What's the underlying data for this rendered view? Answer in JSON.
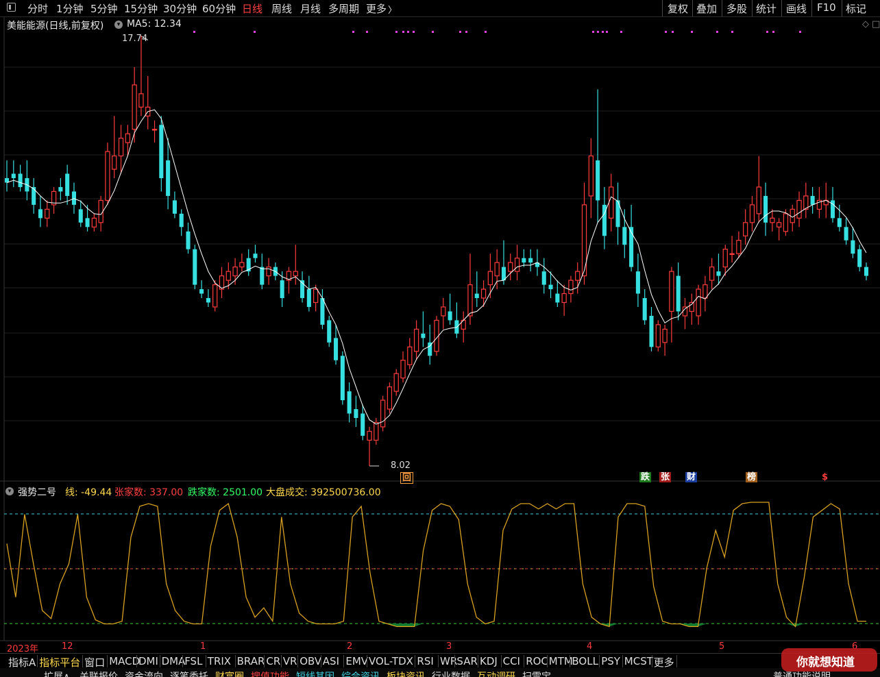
{
  "toolbar": {
    "periods": [
      "分时",
      "1分钟",
      "5分钟",
      "15分钟",
      "30分钟",
      "60分钟",
      "日线",
      "周线",
      "月线",
      "多周期",
      "更多"
    ],
    "active_period": "日线",
    "more_arrow": "〉",
    "tools": [
      "复权",
      "叠加",
      "多股",
      "统计",
      "画线",
      "F10",
      "标记"
    ]
  },
  "header": {
    "stock_title": "美能能源(日线,前复权)",
    "ma_label": "MA5: 12.34",
    "high_label": "17.74",
    "low_label": "8.02"
  },
  "indicator": {
    "name": "强势二号",
    "line_label": "线: -49.44",
    "up_label": "张家数: 337.00",
    "down_label": "跌家数: 2501.00",
    "volume_label": "大盘成交: 392500736.00"
  },
  "markers": {
    "hui": "回",
    "die": "跌",
    "zhang": "张",
    "cai": "财",
    "bang": "榜",
    "dollar": "$"
  },
  "date_axis": [
    "2023年",
    "12",
    "1",
    "2",
    "3",
    "4",
    "5",
    "6"
  ],
  "indicator_tabs": [
    "指标A",
    "指标平台",
    "窗口",
    "MACD",
    "DMI",
    "DMA",
    "FSL",
    "TRIX",
    "BRAR",
    "CR",
    "VR",
    "OBV",
    "ASI",
    "EMV",
    "VOL-TDX",
    "RSI",
    "WR",
    "SAR",
    "KDJ",
    "CCI",
    "ROC",
    "MTM",
    "BOLL",
    "PSY",
    "MCST",
    "更多"
  ],
  "bottom_items": [
    "扩展∧",
    "关联报价",
    "资金流向",
    "逐笔委托",
    "财富圈",
    "搜值功能",
    "短线其因",
    "综合资讯",
    "板块资讯",
    "行业数据",
    "互动调研",
    "扫雷宝"
  ],
  "bottom_right": "普通功能说明",
  "watermark": "你就想知道",
  "chart_data": {
    "type": "candlestick",
    "series_name": "美能能源",
    "ma_period": 5,
    "price_range": [
      8.02,
      17.74
    ],
    "candles": [
      {
        "o": 14.5,
        "h": 14.9,
        "l": 14.2,
        "c": 14.4
      },
      {
        "o": 14.6,
        "h": 14.9,
        "l": 14.3,
        "c": 14.5
      },
      {
        "o": 14.6,
        "h": 14.8,
        "l": 14.2,
        "c": 14.3
      },
      {
        "o": 14.5,
        "h": 14.9,
        "l": 14.0,
        "c": 14.2
      },
      {
        "o": 14.3,
        "h": 14.5,
        "l": 13.7,
        "c": 13.9
      },
      {
        "o": 13.8,
        "h": 14.1,
        "l": 13.4,
        "c": 13.6
      },
      {
        "o": 13.6,
        "h": 14.0,
        "l": 13.4,
        "c": 13.8
      },
      {
        "o": 13.9,
        "h": 14.3,
        "l": 13.7,
        "c": 14.2
      },
      {
        "o": 14.3,
        "h": 14.5,
        "l": 14.0,
        "c": 14.2
      },
      {
        "o": 14.6,
        "h": 14.8,
        "l": 13.9,
        "c": 14.1
      },
      {
        "o": 14.2,
        "h": 14.4,
        "l": 13.7,
        "c": 13.9
      },
      {
        "o": 13.8,
        "h": 14.0,
        "l": 13.4,
        "c": 13.5
      },
      {
        "o": 13.6,
        "h": 13.9,
        "l": 13.3,
        "c": 13.4
      },
      {
        "o": 13.4,
        "h": 13.7,
        "l": 13.3,
        "c": 13.6
      },
      {
        "o": 13.5,
        "h": 14.1,
        "l": 13.3,
        "c": 14.0
      },
      {
        "o": 14.0,
        "h": 15.3,
        "l": 13.9,
        "c": 15.1
      },
      {
        "o": 14.7,
        "h": 15.9,
        "l": 14.5,
        "c": 15.0
      },
      {
        "o": 15.0,
        "h": 15.7,
        "l": 14.6,
        "c": 15.4
      },
      {
        "o": 15.3,
        "h": 15.7,
        "l": 15.0,
        "c": 15.5
      },
      {
        "o": 15.6,
        "h": 17.0,
        "l": 15.3,
        "c": 16.6
      },
      {
        "o": 16.1,
        "h": 17.7,
        "l": 15.9,
        "c": 16.4
      },
      {
        "o": 15.9,
        "h": 16.8,
        "l": 15.6,
        "c": 16.1
      },
      {
        "o": 15.6,
        "h": 15.8,
        "l": 15.3,
        "c": 15.6
      },
      {
        "o": 15.7,
        "h": 15.9,
        "l": 14.2,
        "c": 14.5
      },
      {
        "o": 14.9,
        "h": 15.4,
        "l": 13.8,
        "c": 14.1
      },
      {
        "o": 14.0,
        "h": 14.2,
        "l": 13.6,
        "c": 13.7
      },
      {
        "o": 13.7,
        "h": 13.8,
        "l": 13.2,
        "c": 13.4
      },
      {
        "o": 13.3,
        "h": 13.5,
        "l": 12.8,
        "c": 12.9
      },
      {
        "o": 12.9,
        "h": 13.0,
        "l": 12.0,
        "c": 12.1
      },
      {
        "o": 12.0,
        "h": 12.2,
        "l": 11.8,
        "c": 11.9
      },
      {
        "o": 11.8,
        "h": 12.0,
        "l": 11.6,
        "c": 11.7
      },
      {
        "o": 11.6,
        "h": 12.2,
        "l": 11.5,
        "c": 12.1
      },
      {
        "o": 12.0,
        "h": 12.5,
        "l": 11.8,
        "c": 12.3
      },
      {
        "o": 12.2,
        "h": 12.6,
        "l": 12.0,
        "c": 12.4
      },
      {
        "o": 12.3,
        "h": 12.7,
        "l": 12.1,
        "c": 12.5
      },
      {
        "o": 12.5,
        "h": 12.8,
        "l": 12.4,
        "c": 12.6
      },
      {
        "o": 12.7,
        "h": 12.9,
        "l": 12.3,
        "c": 12.4
      },
      {
        "o": 12.8,
        "h": 13.0,
        "l": 12.6,
        "c": 12.7
      },
      {
        "o": 12.5,
        "h": 12.8,
        "l": 12.0,
        "c": 12.1
      },
      {
        "o": 12.3,
        "h": 12.7,
        "l": 12.1,
        "c": 12.5
      },
      {
        "o": 12.5,
        "h": 12.6,
        "l": 12.2,
        "c": 12.3
      },
      {
        "o": 12.2,
        "h": 12.4,
        "l": 11.6,
        "c": 11.8
      },
      {
        "o": 12.2,
        "h": 12.5,
        "l": 11.9,
        "c": 12.4
      },
      {
        "o": 12.3,
        "h": 13.0,
        "l": 12.1,
        "c": 12.4
      },
      {
        "o": 12.2,
        "h": 12.4,
        "l": 11.7,
        "c": 11.8
      },
      {
        "o": 12.0,
        "h": 12.3,
        "l": 11.5,
        "c": 11.6
      },
      {
        "o": 11.7,
        "h": 12.1,
        "l": 11.5,
        "c": 12.0
      },
      {
        "o": 11.8,
        "h": 12.0,
        "l": 11.1,
        "c": 11.2
      },
      {
        "o": 11.3,
        "h": 11.4,
        "l": 10.7,
        "c": 10.8
      },
      {
        "o": 10.9,
        "h": 11.2,
        "l": 10.3,
        "c": 10.4
      },
      {
        "o": 10.5,
        "h": 10.6,
        "l": 9.4,
        "c": 9.5
      },
      {
        "o": 9.7,
        "h": 9.9,
        "l": 9.0,
        "c": 9.2
      },
      {
        "o": 9.3,
        "h": 9.6,
        "l": 8.9,
        "c": 9.1
      },
      {
        "o": 9.2,
        "h": 9.4,
        "l": 8.6,
        "c": 8.7
      },
      {
        "o": 8.6,
        "h": 8.9,
        "l": 8.02,
        "c": 8.8
      },
      {
        "o": 8.6,
        "h": 9.1,
        "l": 8.5,
        "c": 9.0
      },
      {
        "o": 8.9,
        "h": 9.6,
        "l": 8.8,
        "c": 9.5
      },
      {
        "o": 9.3,
        "h": 9.9,
        "l": 9.2,
        "c": 9.8
      },
      {
        "o": 9.7,
        "h": 10.2,
        "l": 9.6,
        "c": 10.1
      },
      {
        "o": 10.0,
        "h": 10.6,
        "l": 9.9,
        "c": 10.4
      },
      {
        "o": 10.3,
        "h": 10.9,
        "l": 10.2,
        "c": 10.7
      },
      {
        "o": 10.6,
        "h": 11.3,
        "l": 10.4,
        "c": 11.1
      },
      {
        "o": 11.0,
        "h": 11.5,
        "l": 10.7,
        "c": 10.9
      },
      {
        "o": 10.8,
        "h": 11.2,
        "l": 10.3,
        "c": 10.5
      },
      {
        "o": 10.6,
        "h": 11.4,
        "l": 10.5,
        "c": 11.3
      },
      {
        "o": 11.4,
        "h": 11.8,
        "l": 11.1,
        "c": 11.6
      },
      {
        "o": 11.5,
        "h": 11.9,
        "l": 11.2,
        "c": 11.3
      },
      {
        "o": 11.3,
        "h": 11.7,
        "l": 10.9,
        "c": 11.0
      },
      {
        "o": 11.1,
        "h": 11.5,
        "l": 10.8,
        "c": 11.3
      },
      {
        "o": 11.4,
        "h": 12.8,
        "l": 11.2,
        "c": 12.1
      },
      {
        "o": 11.9,
        "h": 12.4,
        "l": 11.6,
        "c": 11.8
      },
      {
        "o": 11.8,
        "h": 12.2,
        "l": 11.6,
        "c": 12.0
      },
      {
        "o": 12.1,
        "h": 12.8,
        "l": 11.8,
        "c": 12.4
      },
      {
        "o": 12.3,
        "h": 12.9,
        "l": 12.0,
        "c": 12.6
      },
      {
        "o": 12.5,
        "h": 13.1,
        "l": 12.1,
        "c": 12.2
      },
      {
        "o": 12.4,
        "h": 12.8,
        "l": 12.2,
        "c": 12.6
      },
      {
        "o": 12.4,
        "h": 13.0,
        "l": 12.2,
        "c": 12.7
      },
      {
        "o": 12.7,
        "h": 12.9,
        "l": 12.5,
        "c": 12.6
      },
      {
        "o": 12.7,
        "h": 12.9,
        "l": 12.4,
        "c": 12.6
      },
      {
        "o": 12.6,
        "h": 12.9,
        "l": 12.3,
        "c": 12.5
      },
      {
        "o": 12.4,
        "h": 12.7,
        "l": 11.9,
        "c": 12.1
      },
      {
        "o": 12.1,
        "h": 12.4,
        "l": 11.8,
        "c": 12.0
      },
      {
        "o": 11.9,
        "h": 12.2,
        "l": 11.6,
        "c": 11.7
      },
      {
        "o": 11.7,
        "h": 12.1,
        "l": 11.4,
        "c": 11.9
      },
      {
        "o": 11.9,
        "h": 12.3,
        "l": 11.7,
        "c": 12.2
      },
      {
        "o": 12.2,
        "h": 12.6,
        "l": 11.9,
        "c": 12.4
      },
      {
        "o": 12.3,
        "h": 14.4,
        "l": 12.1,
        "c": 13.9
      },
      {
        "o": 14.1,
        "h": 15.4,
        "l": 13.6,
        "c": 15.0
      },
      {
        "o": 14.9,
        "h": 16.5,
        "l": 13.5,
        "c": 14.0
      },
      {
        "o": 13.9,
        "h": 14.3,
        "l": 12.9,
        "c": 13.2
      },
      {
        "o": 13.6,
        "h": 14.6,
        "l": 13.3,
        "c": 14.3
      },
      {
        "o": 14.0,
        "h": 14.4,
        "l": 13.0,
        "c": 13.4
      },
      {
        "o": 13.4,
        "h": 13.8,
        "l": 12.7,
        "c": 13.0
      },
      {
        "o": 13.4,
        "h": 13.9,
        "l": 12.4,
        "c": 12.5
      },
      {
        "o": 12.4,
        "h": 12.8,
        "l": 11.6,
        "c": 11.9
      },
      {
        "o": 11.8,
        "h": 12.0,
        "l": 11.2,
        "c": 11.3
      },
      {
        "o": 11.4,
        "h": 11.6,
        "l": 10.6,
        "c": 10.7
      },
      {
        "o": 10.7,
        "h": 11.3,
        "l": 10.6,
        "c": 11.2
      },
      {
        "o": 10.8,
        "h": 11.2,
        "l": 10.5,
        "c": 11.1
      },
      {
        "o": 11.5,
        "h": 12.5,
        "l": 10.8,
        "c": 12.4
      },
      {
        "o": 12.3,
        "h": 12.6,
        "l": 11.3,
        "c": 11.5
      },
      {
        "o": 11.4,
        "h": 11.8,
        "l": 11.1,
        "c": 11.6
      },
      {
        "o": 11.5,
        "h": 11.9,
        "l": 11.2,
        "c": 11.7
      },
      {
        "o": 11.4,
        "h": 12.1,
        "l": 11.2,
        "c": 12.0
      },
      {
        "o": 11.8,
        "h": 12.3,
        "l": 11.5,
        "c": 12.1
      },
      {
        "o": 12.2,
        "h": 12.7,
        "l": 12.0,
        "c": 12.5
      },
      {
        "o": 12.4,
        "h": 12.8,
        "l": 12.1,
        "c": 12.3
      },
      {
        "o": 12.5,
        "h": 13.0,
        "l": 12.3,
        "c": 12.9
      },
      {
        "o": 12.8,
        "h": 13.2,
        "l": 12.6,
        "c": 12.8
      },
      {
        "o": 12.8,
        "h": 13.3,
        "l": 12.7,
        "c": 13.1
      },
      {
        "o": 13.2,
        "h": 13.8,
        "l": 13.0,
        "c": 13.5
      },
      {
        "o": 13.5,
        "h": 14.1,
        "l": 13.3,
        "c": 13.9
      },
      {
        "o": 13.7,
        "h": 15.0,
        "l": 13.5,
        "c": 14.3
      },
      {
        "o": 14.1,
        "h": 14.4,
        "l": 13.2,
        "c": 13.5
      },
      {
        "o": 13.5,
        "h": 13.8,
        "l": 13.3,
        "c": 13.6
      },
      {
        "o": 13.4,
        "h": 13.6,
        "l": 13.1,
        "c": 13.5
      },
      {
        "o": 13.3,
        "h": 13.8,
        "l": 13.2,
        "c": 13.7
      },
      {
        "o": 13.5,
        "h": 13.9,
        "l": 13.3,
        "c": 13.8
      },
      {
        "o": 13.6,
        "h": 14.2,
        "l": 13.4,
        "c": 14.0
      },
      {
        "o": 13.8,
        "h": 14.4,
        "l": 13.6,
        "c": 14.1
      },
      {
        "o": 14.1,
        "h": 14.3,
        "l": 13.7,
        "c": 13.9
      },
      {
        "o": 13.8,
        "h": 14.3,
        "l": 13.6,
        "c": 14.0
      },
      {
        "o": 13.9,
        "h": 14.4,
        "l": 13.6,
        "c": 14.0
      },
      {
        "o": 14.0,
        "h": 14.3,
        "l": 13.5,
        "c": 13.6
      },
      {
        "o": 13.6,
        "h": 13.9,
        "l": 13.3,
        "c": 13.4
      },
      {
        "o": 13.4,
        "h": 13.6,
        "l": 13.0,
        "c": 13.1
      },
      {
        "o": 13.1,
        "h": 13.4,
        "l": 12.7,
        "c": 12.8
      },
      {
        "o": 12.9,
        "h": 13.0,
        "l": 12.4,
        "c": 12.5
      },
      {
        "o": 12.5,
        "h": 12.6,
        "l": 12.2,
        "c": 12.3
      }
    ],
    "oscillator": [
      70,
      30,
      92,
      55,
      20,
      14,
      40,
      55,
      92,
      30,
      13,
      10,
      10,
      12,
      75,
      98,
      100,
      98,
      40,
      20,
      12,
      10,
      10,
      68,
      95,
      100,
      75,
      30,
      15,
      22,
      12,
      90,
      40,
      18,
      12,
      10,
      10,
      10,
      12,
      90,
      98,
      48,
      12,
      10,
      8,
      8,
      8,
      65,
      95,
      100,
      98,
      88,
      40,
      15,
      10,
      12,
      80,
      96,
      100,
      100,
      96,
      100,
      96,
      100,
      100,
      40,
      15,
      10,
      8,
      90,
      100,
      100,
      98,
      38,
      12,
      10,
      10,
      8,
      8,
      52,
      80,
      60,
      95,
      100,
      101,
      101,
      101,
      40,
      15,
      8,
      45,
      90,
      95,
      100,
      96,
      40,
      12,
      12
    ]
  }
}
